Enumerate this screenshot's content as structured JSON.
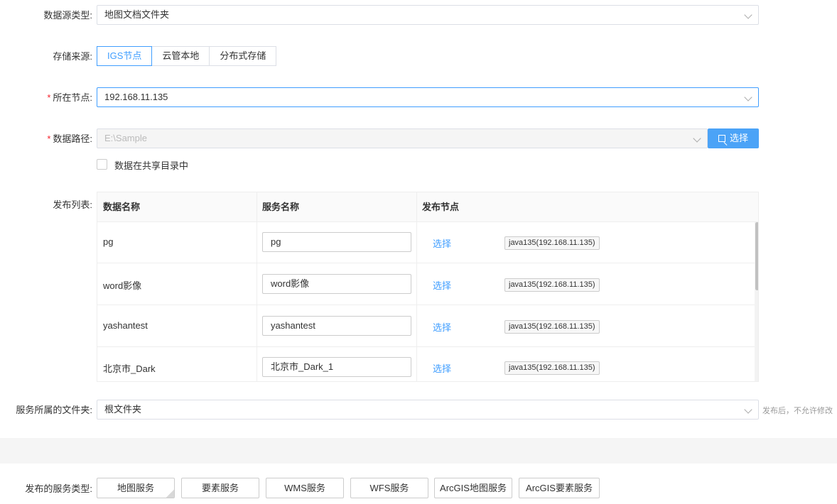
{
  "form": {
    "datasource_type": {
      "label": "数据源类型:",
      "value": "地图文档文件夹"
    },
    "storage_source": {
      "label": "存储来源:",
      "options": [
        "IGS节点",
        "云管本地",
        "分布式存储"
      ],
      "active": "IGS节点"
    },
    "node": {
      "label": "所在节点:",
      "value": "192.168.11.135",
      "required": true
    },
    "data_path": {
      "label": "数据路径:",
      "value": "E:\\Sample",
      "required": true,
      "button_label": "选择"
    },
    "shared_dir": {
      "label": "数据在共享目录中",
      "checked": false
    },
    "publish_list": {
      "label": "发布列表:",
      "columns": [
        "数据名称",
        "服务名称",
        "发布节点"
      ],
      "rows": [
        {
          "data_name": "pg",
          "service_name": "pg",
          "action": "选择",
          "node_tag": "java135(192.168.11.135)"
        },
        {
          "data_name": "word影像",
          "service_name": "word影像",
          "action": "选择",
          "node_tag": "java135(192.168.11.135)"
        },
        {
          "data_name": "yashantest",
          "service_name": "yashantest",
          "action": "选择",
          "node_tag": "java135(192.168.11.135)"
        },
        {
          "data_name": "北京市_Dark",
          "service_name": "北京市_Dark_1",
          "action": "选择",
          "node_tag": "java135(192.168.11.135)"
        }
      ]
    },
    "service_folder": {
      "label": "服务所属的文件夹:",
      "value": "根文件夹",
      "hint": "发布后，不允许修改"
    },
    "service_types": {
      "label": "发布的服务类型:",
      "options": [
        "地图服务",
        "要素服务",
        "WMS服务",
        "WFS服务",
        "ArcGIS地图服务",
        "ArcGIS要素服务"
      ],
      "selected": "地图服务"
    }
  },
  "colors": {
    "accent": "#409eff",
    "primary_button": "#4ba3f7",
    "required": "#f5222d"
  }
}
